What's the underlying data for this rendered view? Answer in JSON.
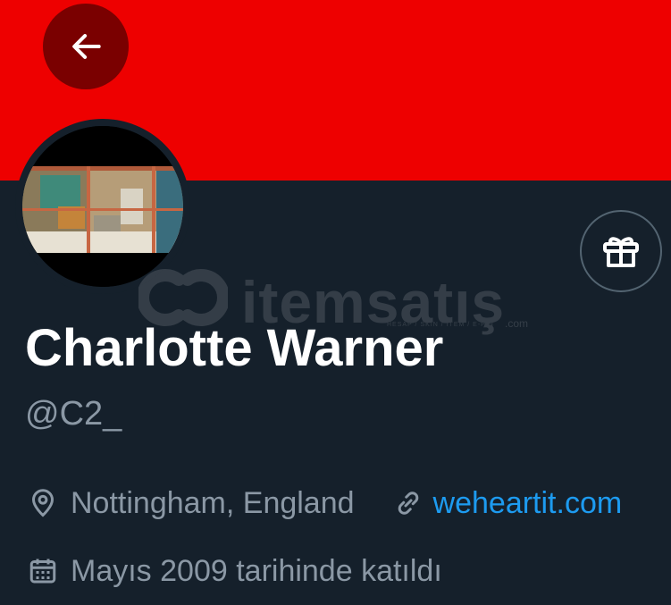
{
  "colors": {
    "banner": "#ee0000",
    "background": "#15202b",
    "back_button": "#7a0000",
    "muted_text": "#8b98a5",
    "link": "#1d9bf0"
  },
  "header": {
    "back_icon": "arrow-left-icon"
  },
  "profile": {
    "display_name": "Charlotte Warner",
    "handle": "@C2_",
    "location": "Nottingham, England",
    "website": "weheartit.com",
    "joined": "Mayıs 2009 tarihinde katıldı"
  },
  "actions": {
    "gift_icon": "gift-icon"
  },
  "watermark": {
    "text": "itemsatış",
    "subtext": "HESAP / SKIN / ITEM / E-PIN",
    "suffix": ".com"
  }
}
